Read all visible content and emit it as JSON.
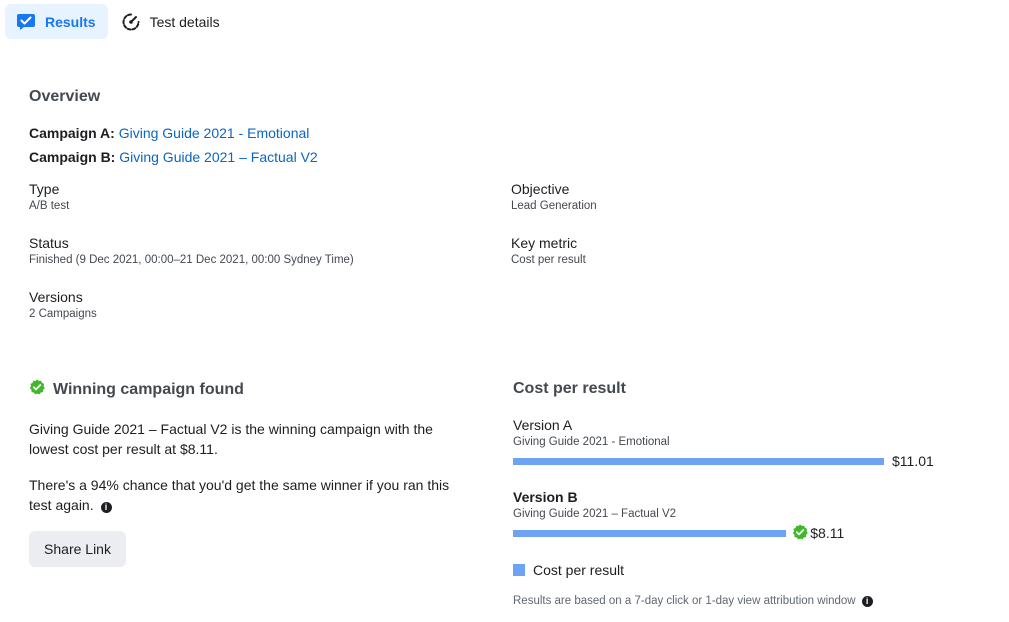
{
  "tabs": [
    {
      "label": "Results",
      "icon": "results-icon",
      "active": true
    },
    {
      "label": "Test details",
      "icon": "speedometer-icon",
      "active": false
    }
  ],
  "overview": {
    "title": "Overview",
    "campaign_a_label": "Campaign A:",
    "campaign_a_name": "Giving Guide 2021 - Emotional",
    "campaign_b_label": "Campaign B:",
    "campaign_b_name": "Giving Guide 2021 – Factual V2",
    "fields": {
      "type": {
        "label": "Type",
        "value": "A/B test"
      },
      "objective": {
        "label": "Objective",
        "value": "Lead Generation"
      },
      "status": {
        "label": "Status",
        "value": "Finished (9 Dec 2021, 00:00–21 Dec 2021, 00:00 Sydney Time)"
      },
      "key_metric": {
        "label": "Key metric",
        "value": "Cost per result"
      },
      "versions": {
        "label": "Versions",
        "value": "2 Campaigns"
      }
    }
  },
  "winner": {
    "title": "Winning campaign found",
    "text1": "Giving Guide 2021 – Factual V2 is the winning campaign with the lowest cost per result at $8.11.",
    "text2": "There's a 94% chance that you'd get the same winner if you ran this test again.",
    "share_button": "Share Link"
  },
  "cost": {
    "title": "Cost per result",
    "versions": [
      {
        "name": "Version A",
        "campaign": "Giving Guide 2021 - Emotional",
        "value_label": "$11.01",
        "value": 11.01,
        "winner": false
      },
      {
        "name": "Version B",
        "campaign": "Giving Guide 2021 – Factual V2",
        "value_label": "$8.11",
        "value": 8.11,
        "winner": true
      }
    ],
    "legend": "Cost per result",
    "footnote": "Results are based on a 7-day click or 1-day view attribution window"
  },
  "colors": {
    "accent": "#1877f2",
    "bar": "#6ea2f2",
    "success": "#42b72a",
    "link": "#0a66c2"
  }
}
